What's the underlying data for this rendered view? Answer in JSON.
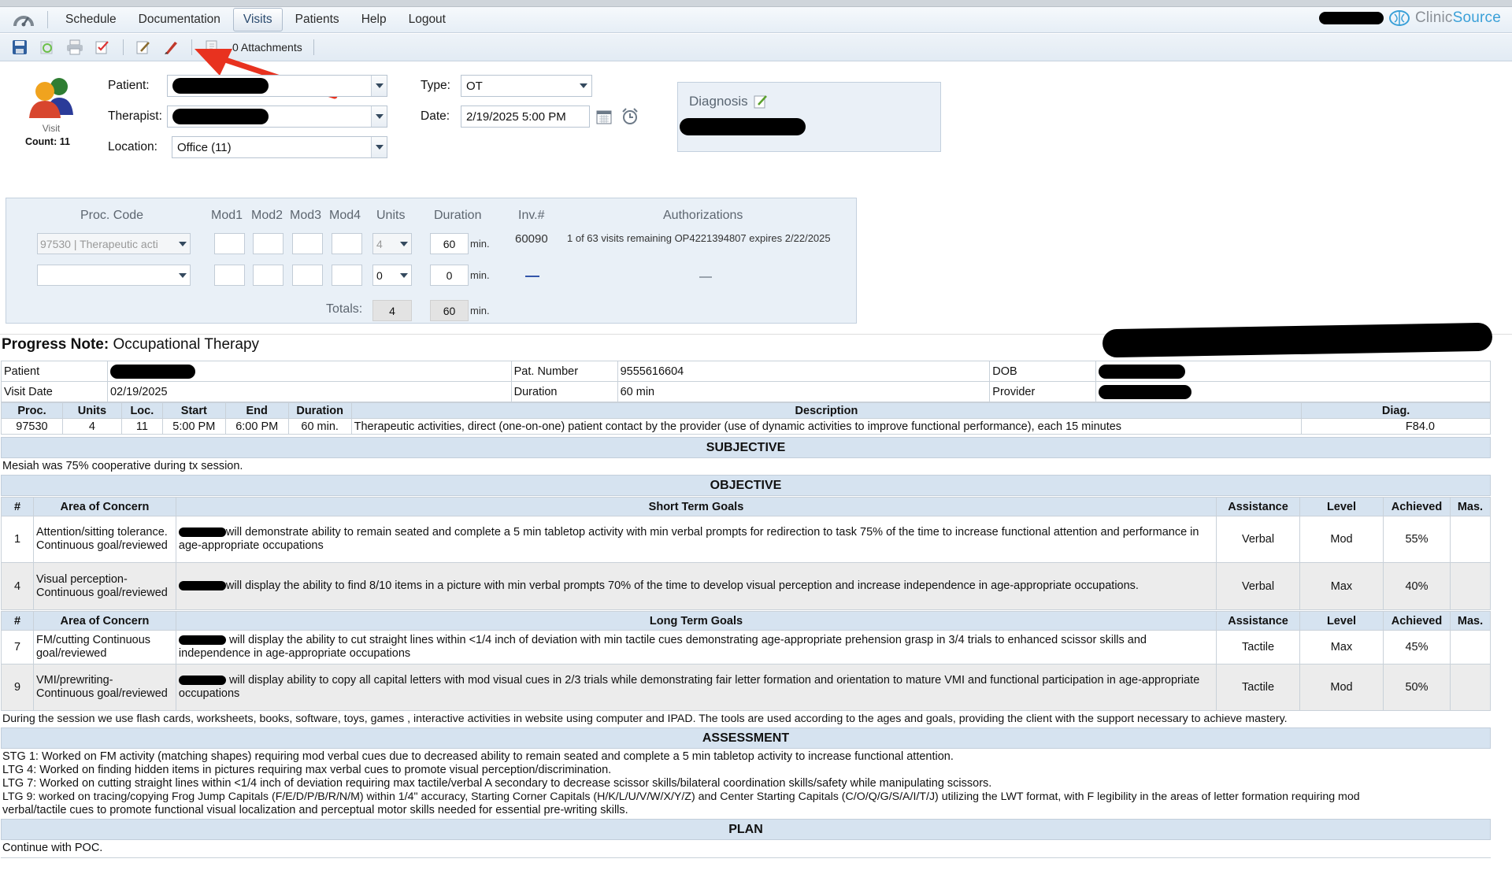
{
  "nav": {
    "items": [
      "Schedule",
      "Documentation",
      "Visits",
      "Patients",
      "Help",
      "Logout"
    ],
    "active": "Visits"
  },
  "brand": {
    "name_part1": "Clinic",
    "name_part2": "Source"
  },
  "toolbar": {
    "icons": [
      "save-icon",
      "refresh-icon",
      "print-icon",
      "check-edit-icon",
      "edit-note-icon",
      "pen-sign-icon",
      "attachment-icon"
    ],
    "attachments_label": "0 Attachments"
  },
  "visit": {
    "icon_label": "Visit",
    "count_label": "Count: 11",
    "patient_label": "Patient:",
    "therapist_label": "Therapist:",
    "location_label": "Location:",
    "location_value": "Office (11)",
    "type_label": "Type:",
    "type_value": "OT",
    "date_label": "Date:",
    "date_value": "2/19/2025 5:00 PM",
    "diagnosis_label": "Diagnosis"
  },
  "proc": {
    "headers": {
      "code": "Proc. Code",
      "mod1": "Mod1",
      "mod2": "Mod2",
      "mod3": "Mod3",
      "mod4": "Mod4",
      "units": "Units",
      "duration": "Duration",
      "inv": "Inv.#",
      "auth": "Authorizations"
    },
    "row1": {
      "code": "97530 | Therapeutic acti",
      "units": "4",
      "duration": "60",
      "min": "min.",
      "inv": "60090",
      "auth": "1 of 63 visits remaining OP4221394807 expires 2/22/2025"
    },
    "row2": {
      "units": "0",
      "duration": "0",
      "min": "min."
    },
    "totals_label": "Totals:",
    "totals_units": "4",
    "totals_duration": "60",
    "totals_min": "min."
  },
  "note": {
    "title_bold": "Progress Note:",
    "title_rest": "Occupational Therapy",
    "patient_label": "Patient",
    "visit_date_label": "Visit Date",
    "visit_date": "02/19/2025",
    "pat_number_label": "Pat. Number",
    "pat_number": "9555616604",
    "duration_label": "Duration",
    "duration": "60 min",
    "dob_label": "DOB",
    "provider_label": "Provider",
    "proc_headers": [
      "Proc.",
      "Units",
      "Loc.",
      "Start",
      "End",
      "Duration",
      "Description",
      "Diag."
    ],
    "proc_row": [
      "97530",
      "4",
      "11",
      "5:00 PM",
      "6:00 PM",
      "60 min.",
      "Therapeutic activities, direct (one-on-one) patient contact by the provider (use of dynamic activities to improve functional performance), each 15 minutes",
      "F84.0"
    ],
    "subjective_label": "SUBJECTIVE",
    "subjective_text": "Mesiah was 75% cooperative during tx session.",
    "objective_label": "OBJECTIVE",
    "stg_headers": [
      "#",
      "Area of Concern",
      "Short Term Goals",
      "Assistance",
      "Level",
      "Achieved",
      "Mas."
    ],
    "stg_rows": [
      {
        "num": "1",
        "area": "Attention/sitting tolerance. Continuous goal/reviewed",
        "goal": "will demonstrate ability to remain seated and complete a 5 min tabletop activity with min verbal prompts for redirection to task 75% of the time to increase functional attention and performance in age-appropriate occupations",
        "assist": "Verbal",
        "level": "Mod",
        "achieved": "55%"
      },
      {
        "num": "4",
        "area": "Visual perception- Continuous goal/reviewed",
        "goal": "will display the ability to find 8/10 items in a picture with min verbal prompts 70% of the time to develop visual perception and increase independence in age-appropriate occupations.",
        "assist": "Verbal",
        "level": "Max",
        "achieved": "40%"
      }
    ],
    "ltg_headers": [
      "#",
      "Area of Concern",
      "Long Term Goals",
      "Assistance",
      "Level",
      "Achieved",
      "Mas."
    ],
    "ltg_rows": [
      {
        "num": "7",
        "area": "FM/cutting Continuous goal/reviewed",
        "goal": "will display the ability to cut straight lines within <1/4 inch of deviation with min tactile cues demonstrating age-appropriate prehension grasp in 3/4 trials to enhanced scissor skills and independence in age-appropriate occupations",
        "assist": "Tactile",
        "level": "Max",
        "achieved": "45%"
      },
      {
        "num": "9",
        "area": "VMI/prewriting- Continuous goal/reviewed",
        "goal": "will display ability to copy all capital letters with mod visual cues in 2/3 trials while demonstrating fair letter formation and orientation to mature VMI and functional participation in age-appropriate occupations",
        "assist": "Tactile",
        "level": "Mod",
        "achieved": "50%"
      }
    ],
    "session_text": "During the session we use flash cards, worksheets, books, software, toys, games , interactive activities in website using computer and IPAD. The tools are used according to the ages and goals, providing the client with the support necessary to achieve mastery.",
    "assessment_label": "ASSESSMENT",
    "assessment_lines": [
      "STG 1: Worked on FM activity (matching shapes) requiring mod verbal cues due to decreased ability to remain seated and complete a 5 min tabletop activity to increase functional attention.",
      "LTG 4: Worked on finding hidden items in pictures requiring max verbal cues to promote visual perception/discrimination.",
      "LTG 7: Worked on cutting straight lines within <1/4 inch of deviation requiring max tactile/verbal A secondary to decrease scissor skills/bilateral coordination skills/safety while manipulating scissors.",
      "LTG 9: worked on tracing/copying Frog Jump Capitals (F/E/D/P/B/R/N/M) within 1/4\" accuracy, Starting Corner Capitals (H/K/L/U/V/W/X/Y/Z) and Center Starting Capitals (C/O/Q/G/S/A/I/T/J) utilizing the LWT format, with F legibility in the areas of letter formation requiring mod",
      "verbal/tactile cues to promote functional visual localization and perceptual motor skills needed for essential pre-writing skills."
    ],
    "plan_label": "PLAN",
    "plan_text": "Continue with POC."
  },
  "colors": {
    "accent": "#3aa0d8",
    "header_bg": "#d6e3f0",
    "panel_bg": "#e9f0f7",
    "arrow": "#e8321f",
    "redaction": "#000000"
  }
}
